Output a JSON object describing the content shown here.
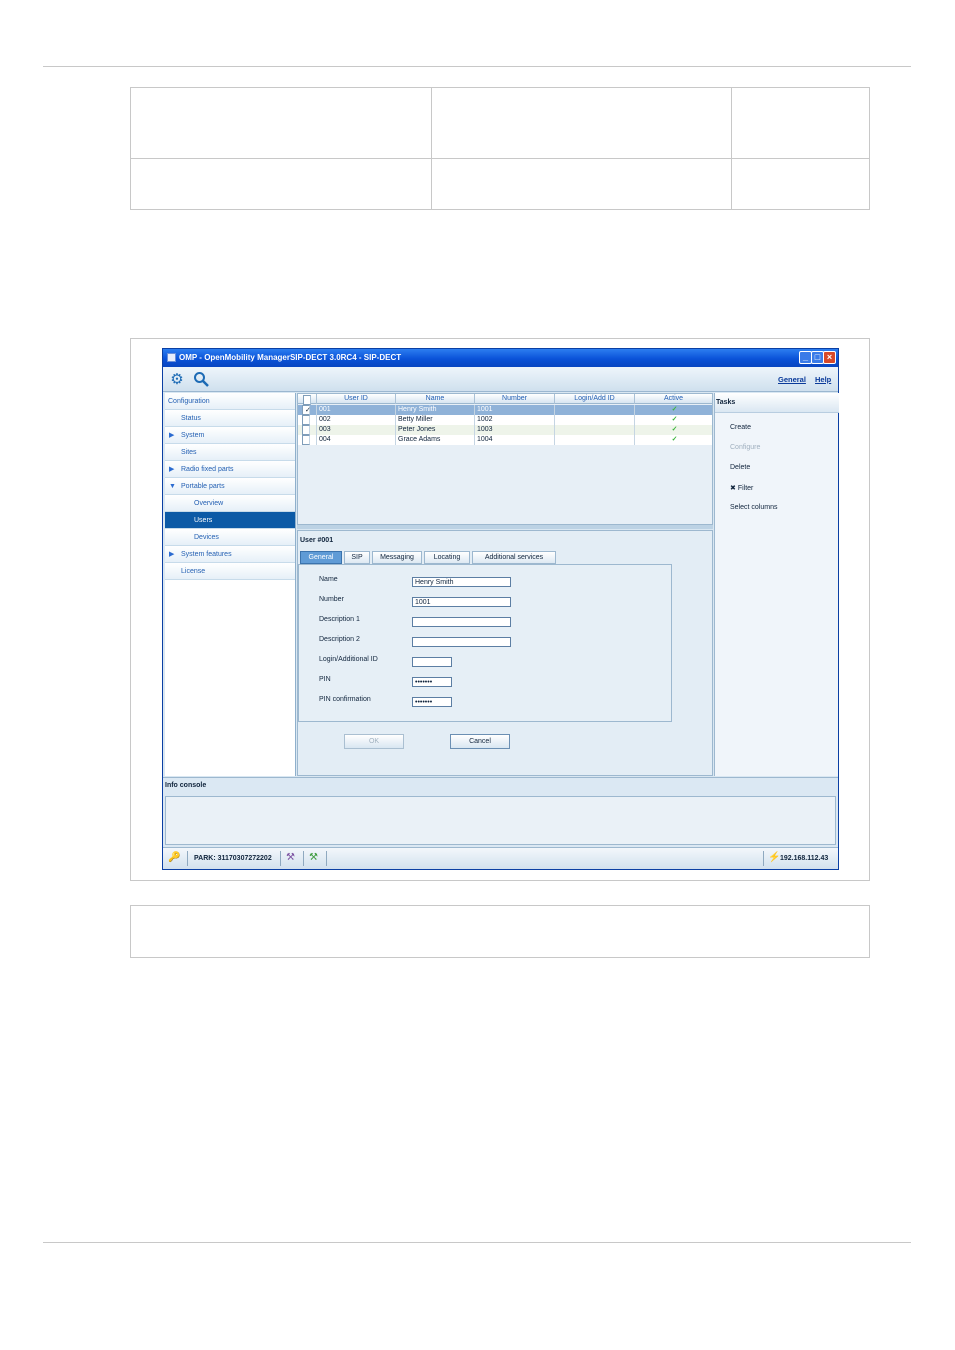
{
  "window": {
    "title": "OMP - OpenMobility ManagerSIP-DECT 3.0RC4 - SIP-DECT",
    "minimize": "_",
    "maximize": "□",
    "close": "×"
  },
  "toolbar": {
    "icons": [
      "gear-icon",
      "search-icon"
    ],
    "links": {
      "general": "General",
      "help": "Help"
    }
  },
  "nav": {
    "items": [
      {
        "label": "Configuration",
        "level": 0,
        "arrow": ""
      },
      {
        "label": "Status",
        "level": 1,
        "arrow": ""
      },
      {
        "label": "System",
        "level": 1,
        "arrow": "▶"
      },
      {
        "label": "Sites",
        "level": 1,
        "arrow": ""
      },
      {
        "label": "Radio fixed parts",
        "level": 1,
        "arrow": "▶"
      },
      {
        "label": "Portable parts",
        "level": 1,
        "arrow": "▼"
      },
      {
        "label": "Overview",
        "level": 2,
        "arrow": ""
      },
      {
        "label": "Users",
        "level": 2,
        "arrow": "",
        "selected": true
      },
      {
        "label": "Devices",
        "level": 2,
        "arrow": ""
      },
      {
        "label": "System features",
        "level": 1,
        "arrow": "▶"
      },
      {
        "label": "License",
        "level": 1,
        "arrow": ""
      }
    ]
  },
  "users_table": {
    "columns": [
      "User ID",
      "Name",
      "Number",
      "Login/Add ID",
      "Active"
    ],
    "rows": [
      {
        "checked": "✓",
        "id": "001",
        "name": "Henry Smith",
        "number": "1001",
        "login": "",
        "active": "✓"
      },
      {
        "checked": "",
        "id": "002",
        "name": "Betty Miller",
        "number": "1002",
        "login": "",
        "active": "✓"
      },
      {
        "checked": "",
        "id": "003",
        "name": "Peter Jones",
        "number": "1003",
        "login": "",
        "active": "✓"
      },
      {
        "checked": "",
        "id": "004",
        "name": "Grace Adams",
        "number": "1004",
        "login": "",
        "active": "✓"
      }
    ]
  },
  "detail": {
    "title": "User #001",
    "tabs": [
      "General",
      "SIP",
      "Messaging",
      "Locating",
      "Additional services"
    ],
    "fields": {
      "name_label": "Name",
      "name_value": "Henry Smith",
      "number_label": "Number",
      "number_value": "1001",
      "desc1_label": "Description 1",
      "desc1_value": "",
      "desc2_label": "Description 2",
      "desc2_value": "",
      "login_label": "Login/Additional ID",
      "login_value": "",
      "pin_label": "PIN",
      "pin_value": "•••••••",
      "pinconf_label": "PIN confirmation",
      "pinconf_value": "•••••••"
    },
    "ok": "OK",
    "cancel": "Cancel"
  },
  "tasks": {
    "title": "Tasks",
    "create": "Create",
    "configure": "Configure",
    "delete": "Delete",
    "filter": "Filter",
    "filter_prefix": "✖",
    "select_columns": "Select columns"
  },
  "console": {
    "title": "Info console"
  },
  "status": {
    "park": "PARK: 31170307272202",
    "ip": "192.168.112.43",
    "key_icon": "🔑",
    "tool_icon_1": "⚒",
    "tool_icon_2": "⚒",
    "plug_icon": "⚡"
  }
}
